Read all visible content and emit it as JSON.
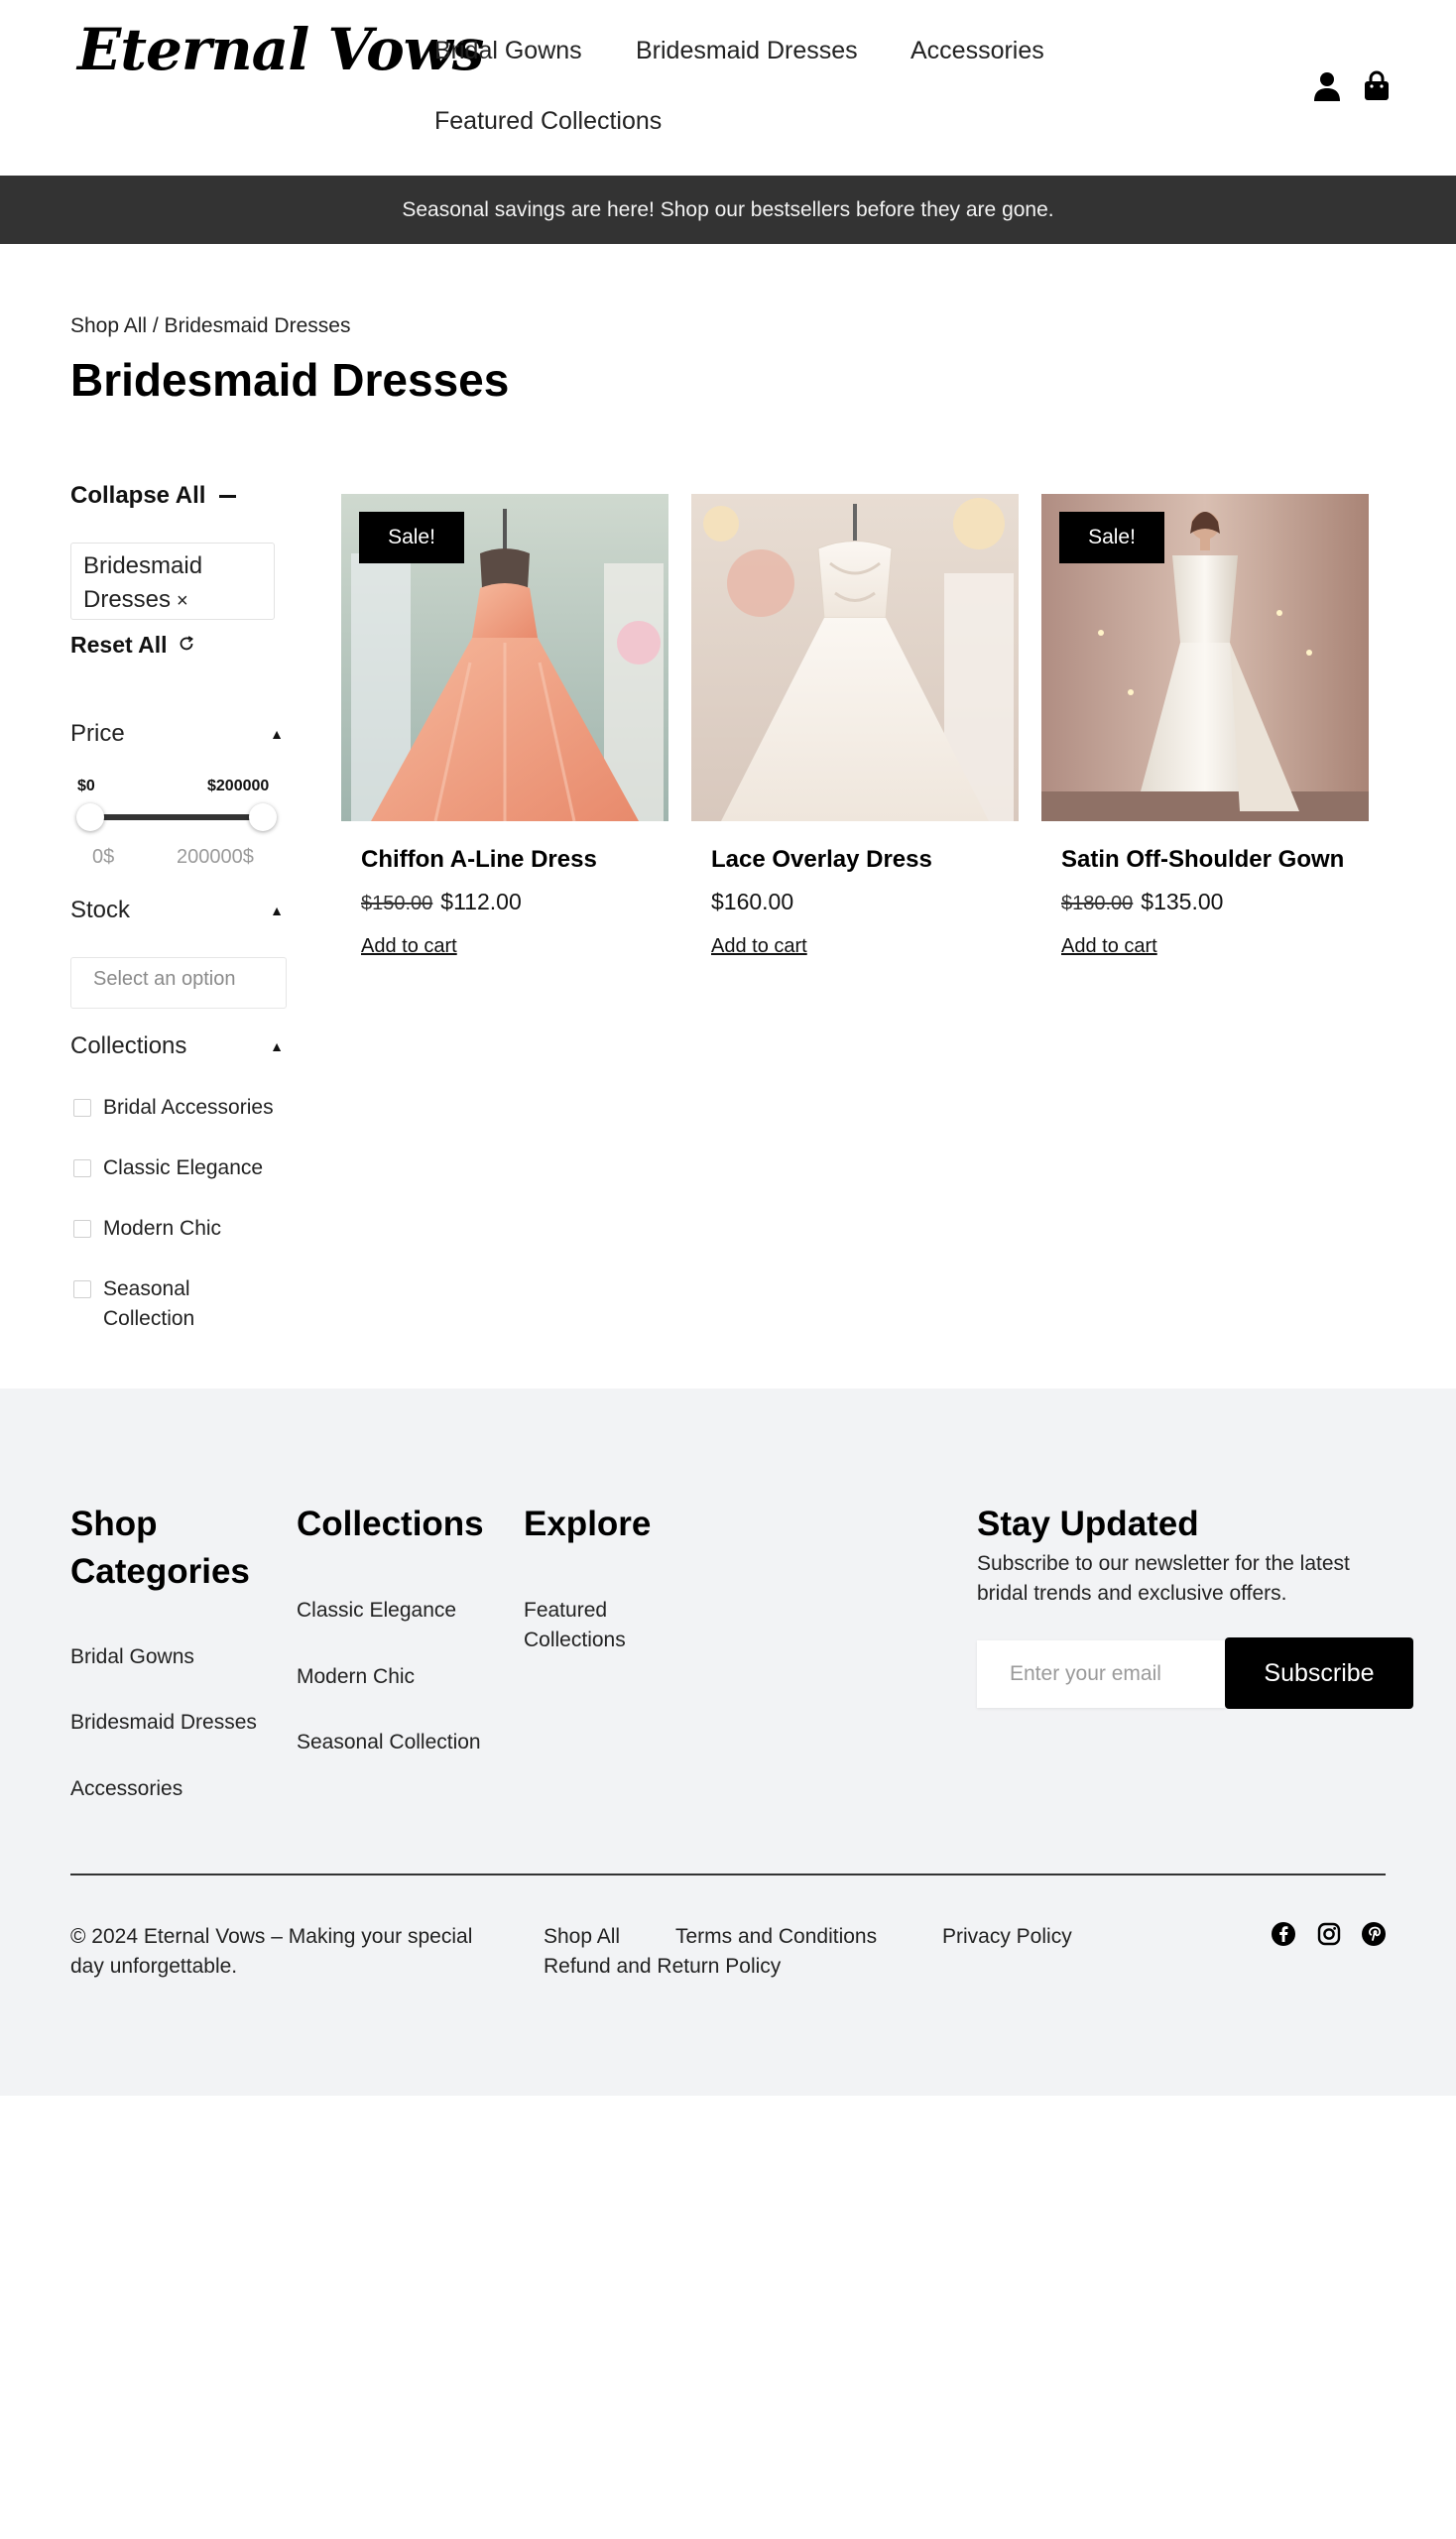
{
  "brand": {
    "logo": "Eternal Vows"
  },
  "nav": {
    "items": [
      {
        "label": "Bridal Gowns"
      },
      {
        "label": "Bridesmaid Dresses"
      },
      {
        "label": "Accessories"
      },
      {
        "label": "Featured Collections"
      }
    ],
    "account_icon": "user-icon",
    "cart_icon": "shopping-bag-icon"
  },
  "announcement": "Seasonal savings are here! Shop our bestsellers before they are gone.",
  "breadcrumb": "Shop All / Bridesmaid Dresses",
  "page_title": "Bridesmaid Dresses",
  "filters": {
    "collapse_all": "Collapse All",
    "active_chip": "Bridesmaid Dresses",
    "active_chip_remove": "×",
    "reset_all": "Reset All",
    "price": {
      "heading": "Price",
      "min_label": "$0",
      "max_label": "$200000",
      "min_input": "0$",
      "max_input": "200000$",
      "range_min": 0,
      "range_max": 200000
    },
    "stock": {
      "heading": "Stock",
      "placeholder": "Select an option"
    },
    "collections": {
      "heading": "Collections",
      "options": [
        {
          "label": "Bridal Accessories"
        },
        {
          "label": "Classic Elegance"
        },
        {
          "label": "Modern Chic"
        },
        {
          "label": "Seasonal Collection"
        }
      ]
    }
  },
  "products": [
    {
      "name": "Chiffon A-Line Dress",
      "sale_badge": "Sale!",
      "old_price": "$150.00",
      "price": "$112.00",
      "cta": "Add to cart",
      "image_color": "#f0a88a"
    },
    {
      "name": "Lace Overlay Dress",
      "sale_badge": "",
      "old_price": "",
      "price": "$160.00",
      "cta": "Add to cart",
      "image_color": "#f6efe8"
    },
    {
      "name": "Satin Off-Shoulder Gown",
      "sale_badge": "Sale!",
      "old_price": "$180.00",
      "price": "$135.00",
      "cta": "Add to cart",
      "image_color": "#efe6dc"
    }
  ],
  "footer": {
    "shop_categories": {
      "heading": "Shop Categories",
      "links": [
        "Bridal Gowns",
        "Bridesmaid Dresses",
        "Accessories"
      ]
    },
    "collections": {
      "heading": "Collections",
      "links": [
        "Classic Elegance",
        "Modern Chic",
        "Seasonal Collection"
      ]
    },
    "explore": {
      "heading": "Explore",
      "links": [
        "Featured Collections"
      ]
    },
    "newsletter": {
      "heading": "Stay Updated",
      "text": "Subscribe to our newsletter for the latest bridal trends and exclusive offers.",
      "placeholder": "Enter your email",
      "button": "Subscribe"
    },
    "copyright": "© 2024 Eternal Vows – Making your special day unforgettable.",
    "legal_links": [
      "Shop All",
      "Terms and Conditions",
      "Privacy Policy",
      "Refund and Return Policy"
    ],
    "social_icons": [
      "facebook-icon",
      "instagram-icon",
      "pinterest-icon"
    ]
  },
  "colors": {
    "announcement_bg": "#333333",
    "footer_bg": "#f2f3f5",
    "button_bg": "#000000"
  }
}
